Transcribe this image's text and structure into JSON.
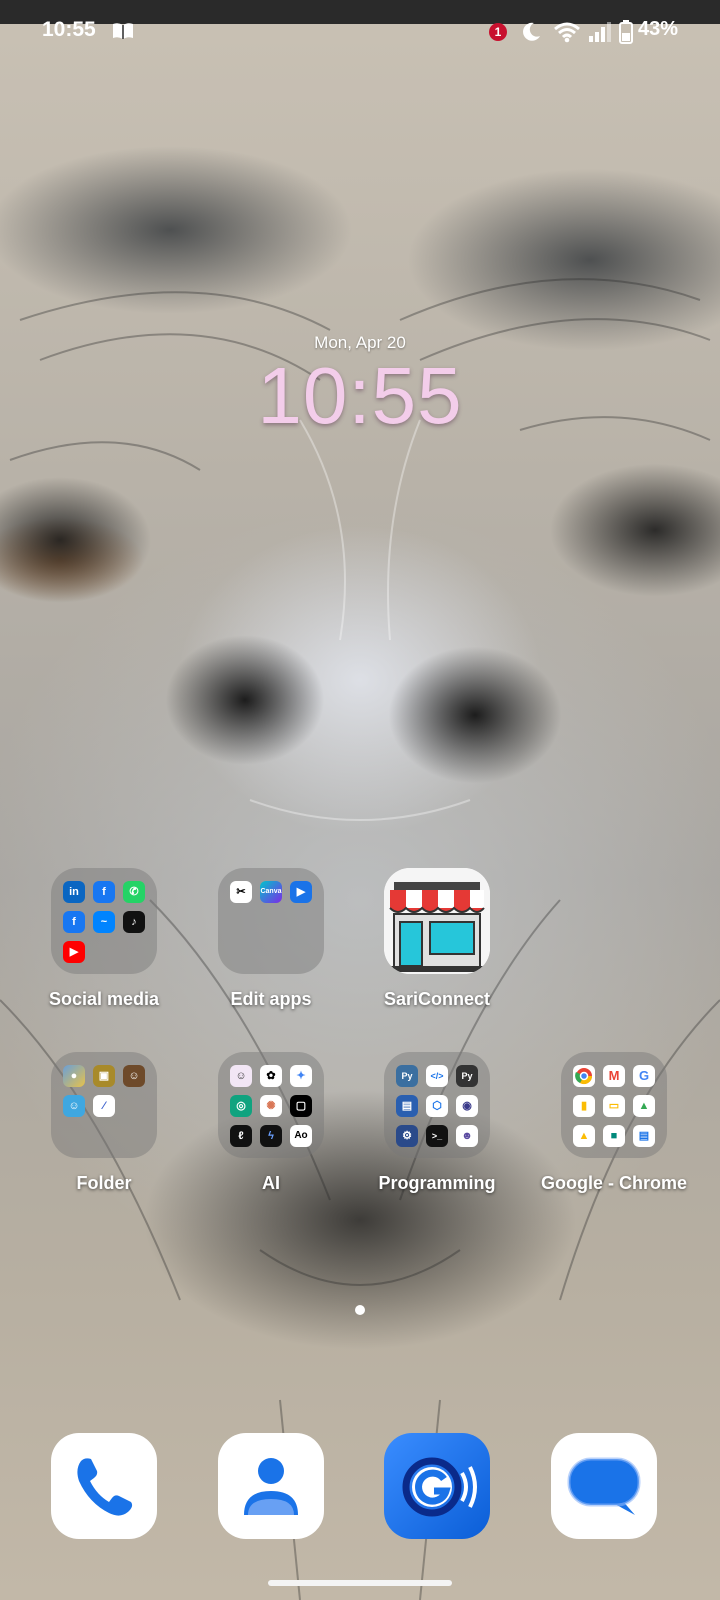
{
  "status_bar": {
    "time": "10:55",
    "notification_count": "1",
    "battery": "43%"
  },
  "clock": {
    "date": "Mon, Apr 20",
    "time": "10:55"
  },
  "home": {
    "row1": [
      {
        "label": "Social media",
        "icons": [
          "in",
          "f",
          "whatsapp",
          "f",
          "messenger",
          "tiktok",
          "youtube"
        ]
      },
      {
        "label": "Edit apps",
        "icons": [
          "capcut",
          "Canva",
          "play"
        ]
      },
      {
        "label": "SariConnect"
      }
    ],
    "row2": [
      {
        "label": "Folder",
        "icons": [
          "game1",
          "game2",
          "game3",
          "game4",
          "game5"
        ]
      },
      {
        "label": "AI",
        "icons": [
          "avatar",
          "chatgpt",
          "gemini",
          "gpt",
          "claude",
          "sparkle",
          "pi",
          "bolt",
          "Ao"
        ]
      },
      {
        "label": "Programming",
        "icons": [
          "Py",
          "code",
          "Py",
          "terminal",
          "box",
          "bot",
          "gear",
          ">_",
          "robot"
        ]
      },
      {
        "label": "Google - Chrome",
        "icons": [
          "chrome",
          "gmail",
          "google",
          "keep",
          "slides",
          "drive",
          "drive",
          "meet",
          "docs"
        ]
      }
    ]
  },
  "dock": [
    {
      "name": "phone"
    },
    {
      "name": "contacts"
    },
    {
      "name": "translate"
    },
    {
      "name": "messages"
    }
  ],
  "colors": {
    "clock_accent": "#f3cdea",
    "badge": "#c8102e",
    "google_blue": "#1a73e8"
  }
}
